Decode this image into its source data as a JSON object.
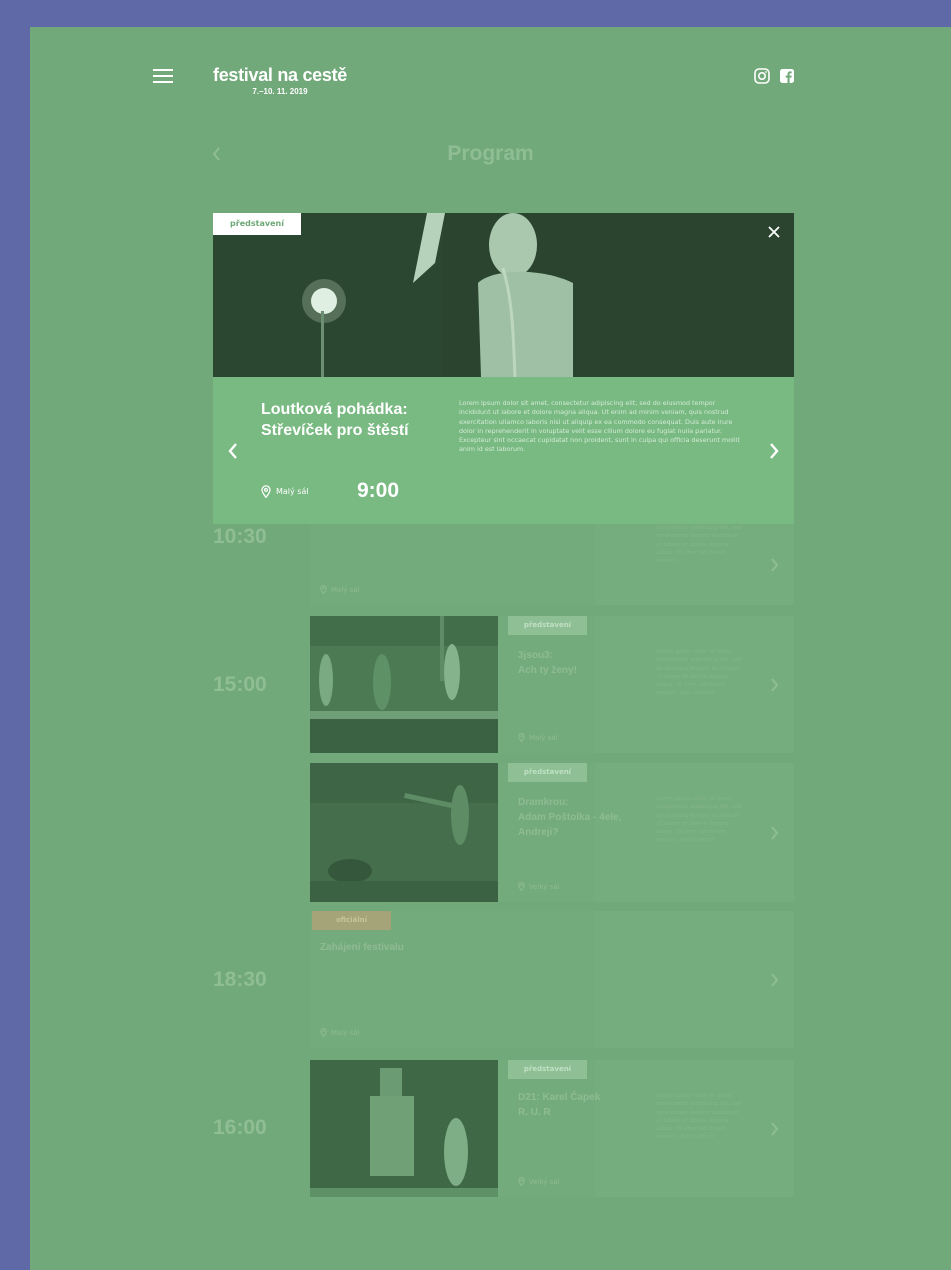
{
  "header": {
    "logo_title": "festival na cestě",
    "logo_dates": "7.–10. 11. 2019"
  },
  "page": {
    "title": "Program"
  },
  "modal": {
    "tag": "představení",
    "title_line1": "Loutková pohádka:",
    "title_line2": "Střevíček pro štěstí",
    "description": "Lorem ipsum dolor sit amet, consectetur adipiscing elit, sed do eiusmod tempor incididunt ut labore et dolore magna aliqua. Ut enim ad minim veniam, quis nostrud exercitation ullamco laboris nisi ut aliquip ex ea commodo consequat. Duis aute irure dolor in reprehenderit in voluptate velit esse cillum dolore eu fugiat nulla pariatur. Excepteur sint occaecat cupidatat non proident, sunt in culpa qui officia deserunt mollit anim id est laborum.",
    "venue": "Malý sál",
    "time": "9:00"
  },
  "schedule": [
    {
      "time": "10:30",
      "venue": "Malý sál",
      "desc": "consectetur adipiscing elit, sed do eiusmod tempor incididunt ut labore et dolore magna aliqua. Ut enim ad minim veniam"
    },
    {
      "time": "15:00",
      "tag": "představení",
      "title_line1": "3jsou3:",
      "title_line2": "Ach ty ženy!",
      "title_line3": "",
      "venue": "Malý sál",
      "desc": "Lorem ipsum dolor sit amet, consectetur adipiscing elit, sed do eiusmod tempor incididunt ut labore et dolore magna aliqua. Ut enim ad minim veniam, quis nostrud"
    },
    {
      "time": "",
      "tag": "představení",
      "title_line1": "Dramkrou:",
      "title_line2": "Adam Poštolka - 4ele,",
      "title_line3": "Andreji?",
      "venue": "Velký sál",
      "desc": "Lorem ipsum dolor sit amet, consectetur adipiscing elit, sed do eiusmod tempor incididunt ut labore et dolore magna aliqua. Ut enim ad minim veniam, quis nostrud"
    },
    {
      "time": "18:30",
      "tag": "oficiální",
      "title_line1": "Zahájení festivalu",
      "venue": "Malý sál"
    },
    {
      "time": "16:00",
      "tag": "představení",
      "title_line1": "D21: Karel Čapek",
      "title_line2": "R. U. R",
      "title_line3": "",
      "venue": "Velký sál",
      "desc": "Lorem ipsum dolor sit amet, consectetur adipiscing elit, sed do eiusmod tempor incididunt ut labore et dolore magna aliqua. Ut enim ad minim veniam, quis nostrud"
    }
  ],
  "icons": {
    "menu": "menu-icon",
    "instagram": "instagram-icon",
    "facebook": "facebook-icon",
    "close": "close-icon",
    "pin": "map-pin-icon"
  }
}
